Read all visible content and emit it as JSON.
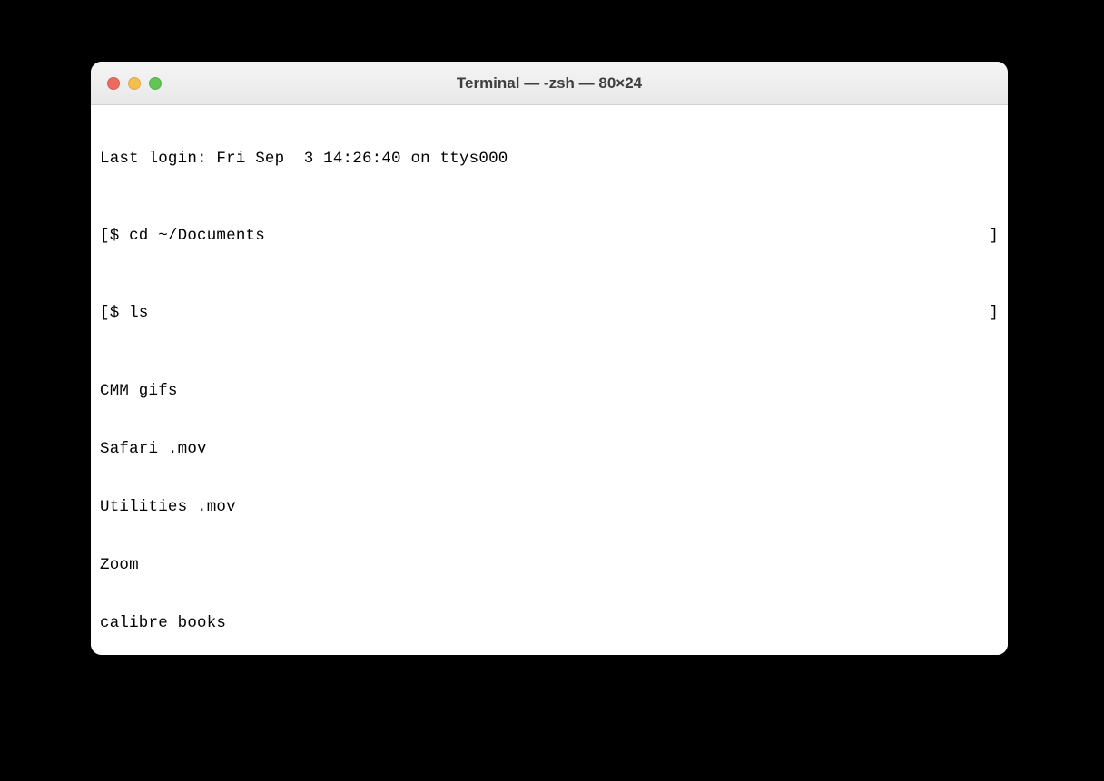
{
  "window": {
    "title": "Terminal — -zsh — 80×24"
  },
  "terminal": {
    "last_login": "Last login: Fri Sep  3 14:26:40 on ttys000",
    "left_bracket": "[",
    "right_bracket": "]",
    "prompt": "$ ",
    "commands": {
      "cd": "$ cd ~/Documents",
      "ls": "$ ls"
    },
    "output": [
      "CMM gifs",
      "Safari .mov",
      "Utilities .mov",
      "Zoom",
      "calibre books"
    ],
    "current_prompt": "$ "
  }
}
